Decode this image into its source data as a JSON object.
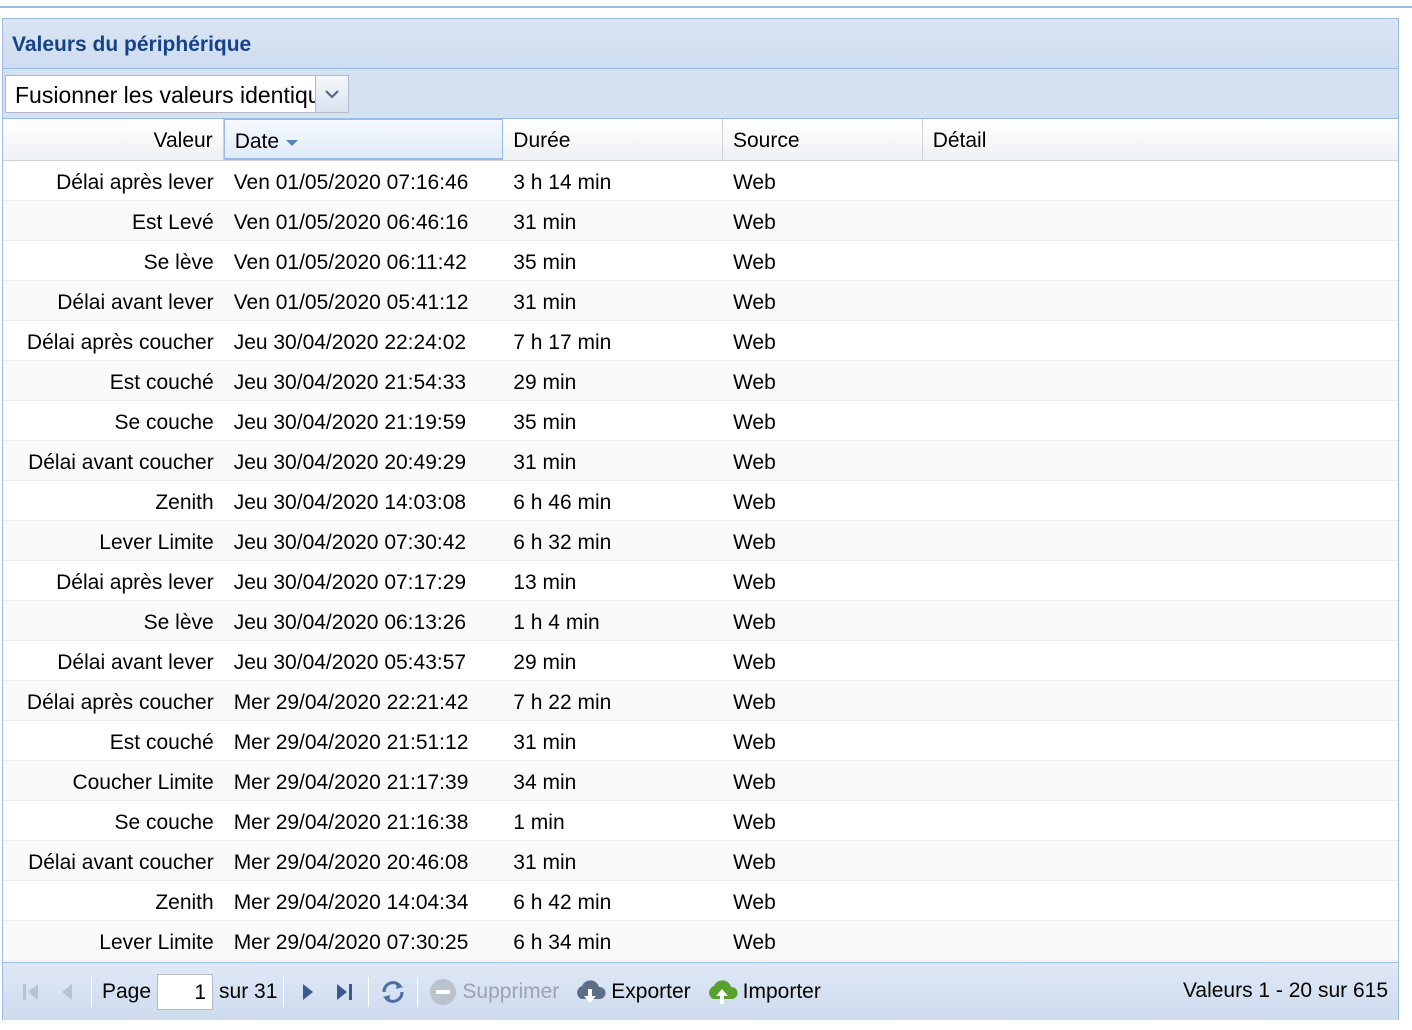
{
  "panel": {
    "title": "Valeurs du périphérique"
  },
  "toolbar": {
    "merge_combo_value": "Fusionner les valeurs identiques"
  },
  "columns": [
    "Valeur",
    "Date",
    "Durée",
    "Source",
    "Détail"
  ],
  "rows": [
    {
      "valeur": "Délai après lever",
      "date": "Ven 01/05/2020 07:16:46",
      "duree": "3 h 14 min",
      "source": "Web",
      "detail": ""
    },
    {
      "valeur": "Est Levé",
      "date": "Ven 01/05/2020 06:46:16",
      "duree": "31 min",
      "source": "Web",
      "detail": ""
    },
    {
      "valeur": "Se lève",
      "date": "Ven 01/05/2020 06:11:42",
      "duree": "35 min",
      "source": "Web",
      "detail": ""
    },
    {
      "valeur": "Délai avant lever",
      "date": "Ven 01/05/2020 05:41:12",
      "duree": "31 min",
      "source": "Web",
      "detail": ""
    },
    {
      "valeur": "Délai après coucher",
      "date": "Jeu 30/04/2020 22:24:02",
      "duree": "7 h 17 min",
      "source": "Web",
      "detail": ""
    },
    {
      "valeur": "Est couché",
      "date": "Jeu 30/04/2020 21:54:33",
      "duree": "29 min",
      "source": "Web",
      "detail": ""
    },
    {
      "valeur": "Se couche",
      "date": "Jeu 30/04/2020 21:19:59",
      "duree": "35 min",
      "source": "Web",
      "detail": ""
    },
    {
      "valeur": "Délai avant coucher",
      "date": "Jeu 30/04/2020 20:49:29",
      "duree": "31 min",
      "source": "Web",
      "detail": ""
    },
    {
      "valeur": "Zenith",
      "date": "Jeu 30/04/2020 14:03:08",
      "duree": "6 h 46 min",
      "source": "Web",
      "detail": ""
    },
    {
      "valeur": "Lever Limite",
      "date": "Jeu 30/04/2020 07:30:42",
      "duree": "6 h 32 min",
      "source": "Web",
      "detail": ""
    },
    {
      "valeur": "Délai après lever",
      "date": "Jeu 30/04/2020 07:17:29",
      "duree": "13 min",
      "source": "Web",
      "detail": ""
    },
    {
      "valeur": "Se lève",
      "date": "Jeu 30/04/2020 06:13:26",
      "duree": "1 h 4 min",
      "source": "Web",
      "detail": ""
    },
    {
      "valeur": "Délai avant lever",
      "date": "Jeu 30/04/2020 05:43:57",
      "duree": "29 min",
      "source": "Web",
      "detail": ""
    },
    {
      "valeur": "Délai après coucher",
      "date": "Mer 29/04/2020 22:21:42",
      "duree": "7 h 22 min",
      "source": "Web",
      "detail": ""
    },
    {
      "valeur": "Est couché",
      "date": "Mer 29/04/2020 21:51:12",
      "duree": "31 min",
      "source": "Web",
      "detail": ""
    },
    {
      "valeur": "Coucher Limite",
      "date": "Mer 29/04/2020 21:17:39",
      "duree": "34 min",
      "source": "Web",
      "detail": ""
    },
    {
      "valeur": "Se couche",
      "date": "Mer 29/04/2020 21:16:38",
      "duree": "1 min",
      "source": "Web",
      "detail": ""
    },
    {
      "valeur": "Délai avant coucher",
      "date": "Mer 29/04/2020 20:46:08",
      "duree": "31 min",
      "source": "Web",
      "detail": ""
    },
    {
      "valeur": "Zenith",
      "date": "Mer 29/04/2020 14:04:34",
      "duree": "6 h 42 min",
      "source": "Web",
      "detail": ""
    },
    {
      "valeur": "Lever Limite",
      "date": "Mer 29/04/2020 07:30:25",
      "duree": "6 h 34 min",
      "source": "Web",
      "detail": ""
    }
  ],
  "pager": {
    "page_label": "Page",
    "page_value": "1",
    "of_label": "sur 31",
    "delete_label": "Supprimer",
    "export_label": "Exporter",
    "import_label": "Importer",
    "info": "Valeurs 1 - 20 sur 615"
  },
  "colors": {
    "header_blue": "#15428b",
    "border_blue": "#99bbe8",
    "panel_bg": "#d3e1f1",
    "import_green": "#5aa02c"
  }
}
